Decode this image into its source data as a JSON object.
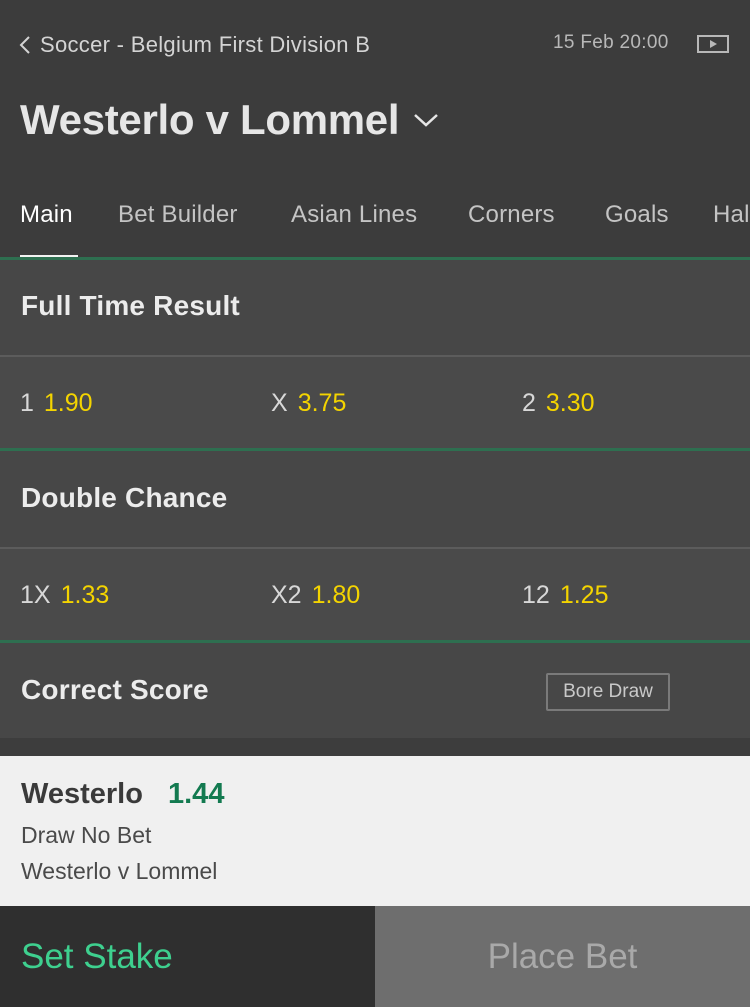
{
  "header": {
    "breadcrumb": "Soccer - Belgium First Division B",
    "datetime": "15 Feb 20:00",
    "title": "Westerlo v Lommel"
  },
  "tabs": [
    "Main",
    "Bet Builder",
    "Asian Lines",
    "Corners",
    "Goals",
    "Hal"
  ],
  "active_tab": "Main",
  "markets": {
    "full_time_result": {
      "title": "Full Time Result",
      "selections": [
        {
          "label": "1",
          "price": "1.90"
        },
        {
          "label": "X",
          "price": "3.75"
        },
        {
          "label": "2",
          "price": "3.30"
        }
      ]
    },
    "double_chance": {
      "title": "Double Chance",
      "selections": [
        {
          "label": "1X",
          "price": "1.33"
        },
        {
          "label": "X2",
          "price": "1.80"
        },
        {
          "label": "12",
          "price": "1.25"
        }
      ]
    },
    "correct_score": {
      "title": "Correct Score",
      "button": "Bore Draw"
    }
  },
  "betslip": {
    "selection": "Westerlo",
    "price": "1.44",
    "market": "Draw No Bet",
    "event": "Westerlo v Lommel",
    "set_stake_label": "Set Stake",
    "place_bet_label": "Place Bet"
  },
  "colors": {
    "accent_green": "#3ed08f",
    "price_yellow": "#f4d400",
    "slip_price_green": "#137a50",
    "separator_green": "#2e6f50"
  }
}
